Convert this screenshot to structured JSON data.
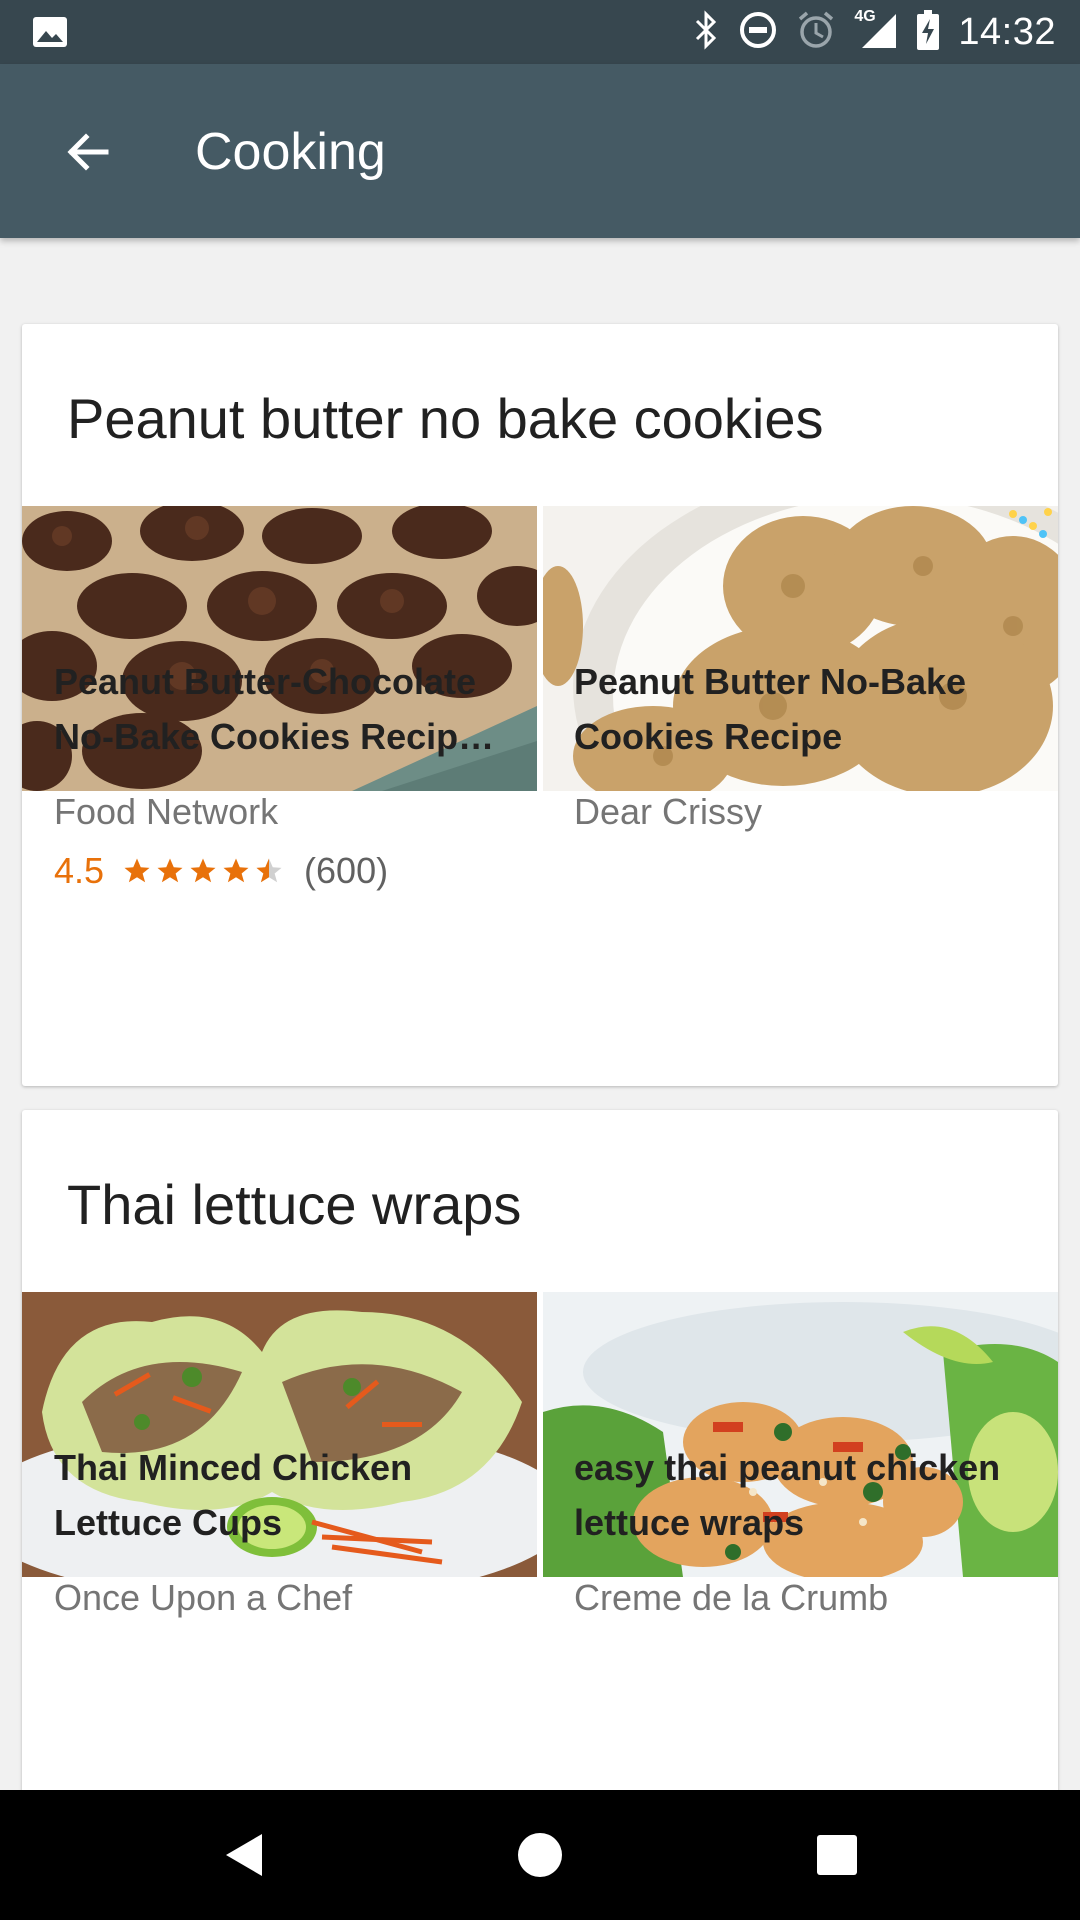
{
  "status_bar": {
    "time": "14:32",
    "network": "4G",
    "icons": [
      "image-icon",
      "bluetooth-icon",
      "do-not-disturb-icon",
      "alarm-icon",
      "signal-icon",
      "battery-charging-icon"
    ]
  },
  "app_bar": {
    "title": "Cooking",
    "back_icon": "arrow-back-icon"
  },
  "colors": {
    "status_bar": "#37474f",
    "app_bar": "#455a64",
    "rating": "#e8710a",
    "background": "#f1f1f1"
  },
  "cards": [
    {
      "title": "Peanut butter no bake cookies",
      "items": [
        {
          "title_line1": "Peanut Butter-Chocolate",
          "title_line2": "No-Bake Cookies Recipe…",
          "source": "Food Network",
          "rating": "4.5",
          "stars": 4.5,
          "reviews": "(600)",
          "image": "chocolate-no-bake-cookies-photo"
        },
        {
          "title_line1": "Peanut Butter No-Bake",
          "title_line2": "Cookies Recipe",
          "source": "Dear Crissy",
          "image": "peanut-butter-cookies-photo"
        }
      ]
    },
    {
      "title": "Thai lettuce wraps",
      "items": [
        {
          "title_line1": "Thai Minced Chicken",
          "title_line2": "Lettuce Cups",
          "source": "Once Upon a Chef",
          "image": "lettuce-cups-photo"
        },
        {
          "title_line1": "easy thai peanut chicken",
          "title_line2": "lettuce wraps",
          "source": "Creme de la Crumb",
          "image": "peanut-chicken-wraps-photo"
        }
      ]
    }
  ],
  "nav_bar": {
    "icons": [
      "back-triangle-icon",
      "home-circle-icon",
      "recents-square-icon"
    ]
  }
}
